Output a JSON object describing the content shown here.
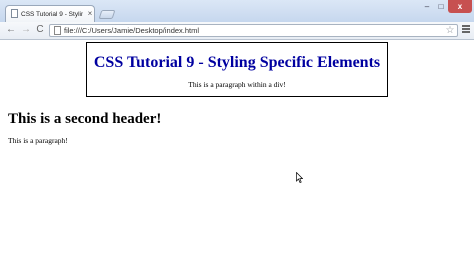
{
  "browser": {
    "tab": {
      "title": "CSS Tutorial 9 - Styling Sp..."
    },
    "window_controls": {
      "minimize": "–",
      "maximize": "□",
      "close": "x"
    },
    "toolbar": {
      "back_glyph": "←",
      "forward_glyph": "→",
      "reload_glyph": "C",
      "url": "file:///C:/Users/Jamie/Desktop/index.html",
      "star_glyph": "☆"
    }
  },
  "page": {
    "div_heading": "CSS Tutorial 9 - Styling Specific Elements",
    "div_paragraph": "This is a paragraph within a div!",
    "second_header": "This is a second header!",
    "paragraph": "This is a paragraph!"
  },
  "colors": {
    "div_heading": "#0000a0",
    "tab_close_button": "#c75050"
  }
}
